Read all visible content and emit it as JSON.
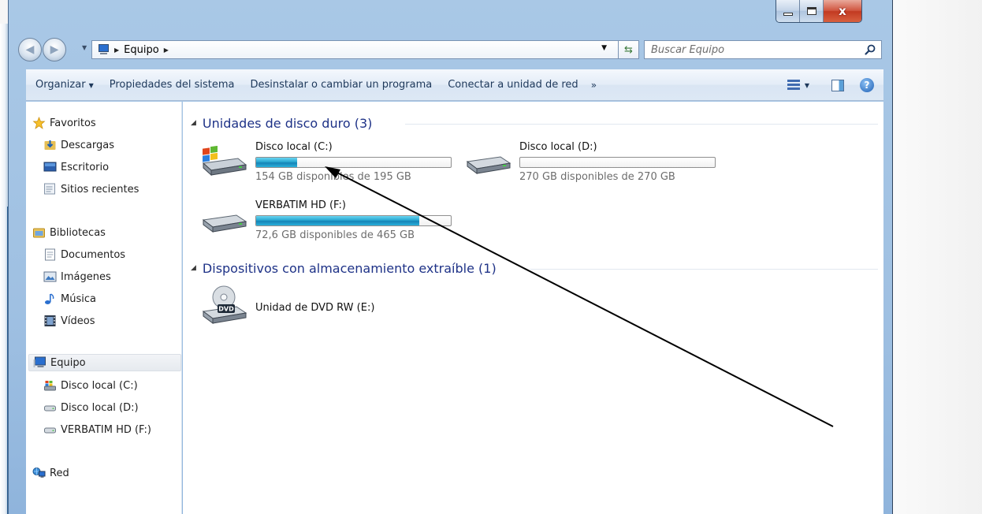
{
  "window": {
    "close_glyph": "x"
  },
  "nav": {
    "address_segment": "Equipo",
    "search_placeholder": "Buscar Equipo"
  },
  "toolbar": {
    "organize": "Organizar",
    "system_properties": "Propiedades del sistema",
    "uninstall": "Desinstalar o cambiar un programa",
    "map_drive": "Conectar a unidad de red",
    "more": "»",
    "help": "?"
  },
  "sidebar": {
    "favorites": {
      "label": "Favoritos",
      "items": [
        "Descargas",
        "Escritorio",
        "Sitios recientes"
      ]
    },
    "libraries": {
      "label": "Bibliotecas",
      "items": [
        "Documentos",
        "Imágenes",
        "Música",
        "Vídeos"
      ]
    },
    "computer": {
      "label": "Equipo",
      "items": [
        "Disco local (C:)",
        "Disco local (D:)",
        "VERBATIM HD (F:)"
      ]
    },
    "network": {
      "label": "Red"
    }
  },
  "content": {
    "hard_drives_group": "Unidades de disco duro (3)",
    "removable_group": "Dispositivos con almacenamiento extraíble (1)",
    "drives": [
      {
        "name": "Disco local (C:)",
        "free_text": "154 GB disponibles de 195 GB",
        "used_fraction": 0.21
      },
      {
        "name": "Disco local (D:)",
        "free_text": "270 GB disponibles de 270 GB",
        "used_fraction": 0.0
      },
      {
        "name": "VERBATIM HD (F:)",
        "free_text": "72,6 GB disponibles de 465 GB",
        "used_fraction": 0.84
      }
    ],
    "dvd": {
      "name": "Unidad de DVD RW (E:)",
      "badge": "DVD"
    }
  },
  "colors": {
    "group_title": "#1e3287",
    "toolbar_text": "#1e395b",
    "frame_blue": "#9fc0e2"
  }
}
